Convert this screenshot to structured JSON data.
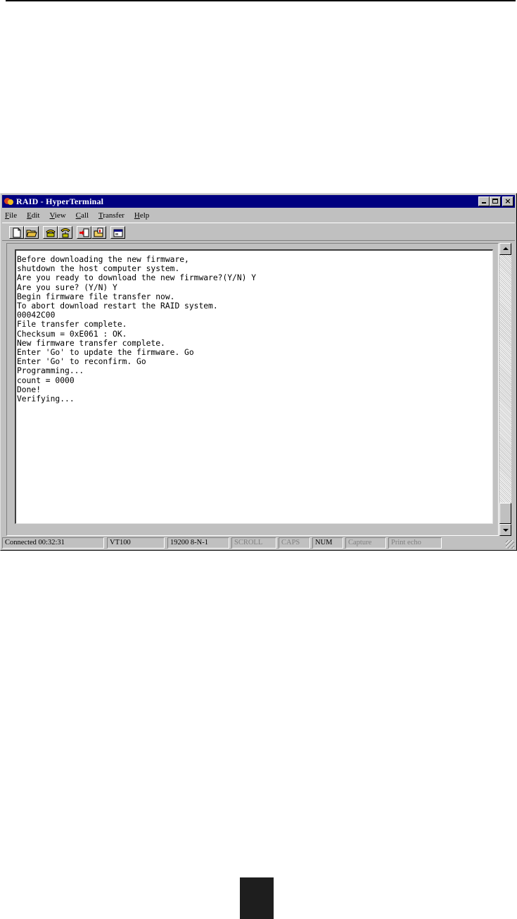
{
  "window": {
    "title": "RAID - HyperTerminal"
  },
  "menu": {
    "items": [
      {
        "key": "F",
        "rest": "ile"
      },
      {
        "key": "E",
        "rest": "dit"
      },
      {
        "key": "V",
        "rest": "iew"
      },
      {
        "key": "C",
        "rest": "all"
      },
      {
        "key": "T",
        "rest": "ransfer"
      },
      {
        "key": "H",
        "rest": "elp"
      }
    ]
  },
  "toolbar": {
    "icons": [
      "new-document-icon",
      "open-folder-icon",
      "connect-phone-icon",
      "disconnect-phone-icon",
      "send-file-icon",
      "receive-file-icon",
      "properties-icon"
    ]
  },
  "terminal": {
    "lines": [
      "Before downloading the new firmware,",
      "shutdown the host computer system.",
      "Are you ready to download the new firmware?(Y/N) Y",
      "Are you sure? (Y/N) Y",
      "Begin firmware file transfer now.",
      "To abort download restart the RAID system.",
      "00042C00",
      "File transfer complete.",
      "Checksum = 0xE061 : OK.",
      "New firmware transfer complete.",
      "Enter 'Go' to update the firmware. Go",
      "Enter 'Go' to reconfirm. Go",
      "Programming...",
      "count = 0000",
      "Done!",
      "Verifying..."
    ]
  },
  "status": {
    "connected": "Connected 00:32:31",
    "emulation": "VT100",
    "settings": "19200 8-N-1",
    "scroll": "SCROLL",
    "caps": "CAPS",
    "num": "NUM",
    "capture": "Capture",
    "print_echo": "Print echo"
  }
}
